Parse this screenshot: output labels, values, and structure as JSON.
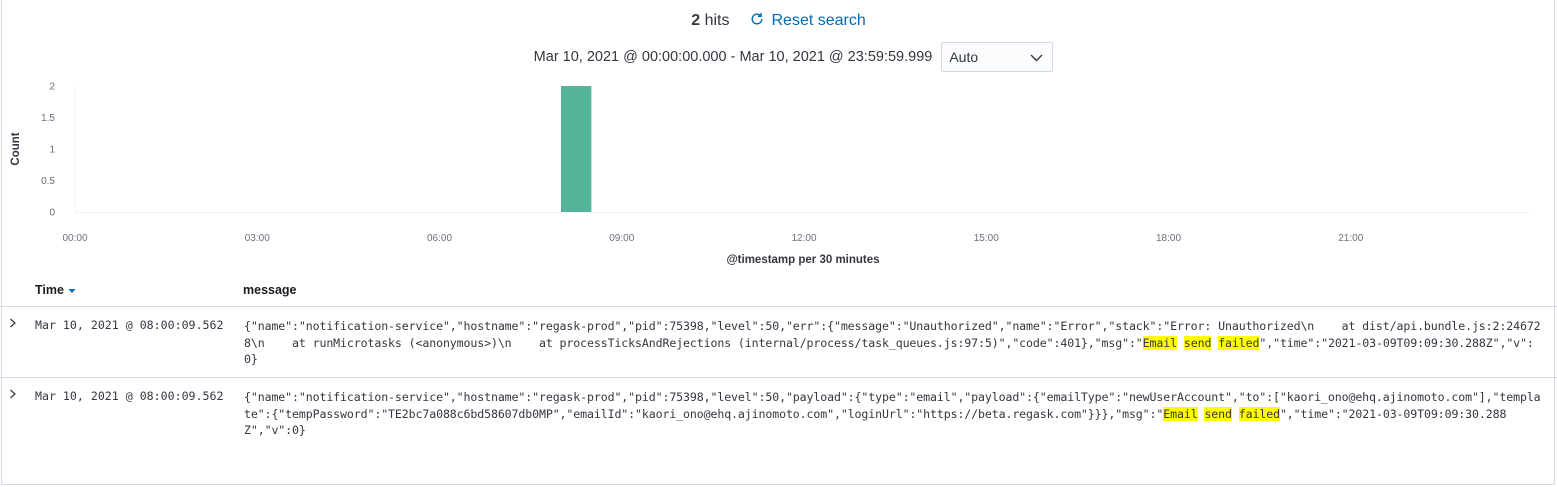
{
  "hits": {
    "count": "2",
    "label": "hits"
  },
  "reset_search": {
    "label": "Reset search",
    "icon": "refresh-icon"
  },
  "time_range": {
    "label": "Mar 10, 2021 @ 00:00:00.000 - Mar 10, 2021 @ 23:59:59.999"
  },
  "interval": {
    "selected": "Auto",
    "icon": "chevron-down-icon"
  },
  "chart_data": {
    "type": "bar",
    "xlabel": "@timestamp per 30 minutes",
    "ylabel": "Count",
    "x_ticks": [
      "00:00",
      "03:00",
      "06:00",
      "09:00",
      "12:00",
      "15:00",
      "18:00",
      "21:00"
    ],
    "y_ticks": [
      "0",
      "0.5",
      "1",
      "1.5",
      "2"
    ],
    "ylim": [
      0,
      2
    ],
    "xlim_hours": [
      0,
      24
    ],
    "bar_width_hours": 0.5,
    "bars": [
      {
        "x": "08:00",
        "start_hour": 8,
        "value": 2
      }
    ],
    "colors": {
      "bar": "#54b399"
    },
    "grid": false,
    "legend": "none"
  },
  "table": {
    "columns": {
      "time": "Time",
      "message": "message"
    },
    "sort_icon": "sort-down-icon",
    "rows": [
      {
        "time": "Mar 10, 2021 @ 08:00:09.562",
        "message": {
          "pre": "{\"name\":\"notification-service\",\"hostname\":\"regask-prod\",\"pid\":75398,\"level\":50,\"err\":{\"message\":\"Unauthorized\",\"name\":\"Error\",\"stack\":\"Error: Unauthorized\\n    at dist/api.bundle.js:2:246728\\n    at runMicrotasks (<anonymous>)\\n    at processTicksAndRejections (internal/process/task_queues.js:97:5)\",\"code\":401},\"msg\":\"",
          "hl1": "Email",
          "sp1": " ",
          "hl2": "send",
          "sp2": " ",
          "hl3": "failed",
          "post": "\",\"time\":\"2021-03-09T09:09:30.288Z\",\"v\":0}"
        }
      },
      {
        "time": "Mar 10, 2021 @ 08:00:09.562",
        "message": {
          "pre": "{\"name\":\"notification-service\",\"hostname\":\"regask-prod\",\"pid\":75398,\"level\":50,\"payload\":{\"type\":\"email\",\"payload\":{\"emailType\":\"newUserAccount\",\"to\":[\"kaori_ono@ehq.ajinomoto.com\"],\"template\":{\"tempPassword\":\"TE2bc7a088c6bd58607db0MP\",\"emailId\":\"kaori_ono@ehq.ajinomoto.com\",\"loginUrl\":\"https://beta.regask.com\"}}},\"msg\":\"",
          "hl1": "Email",
          "sp1": " ",
          "hl2": "send",
          "sp2": " ",
          "hl3": "failed",
          "post": "\",\"time\":\"2021-03-09T09:09:30.288Z\",\"v\":0}"
        }
      }
    ]
  }
}
